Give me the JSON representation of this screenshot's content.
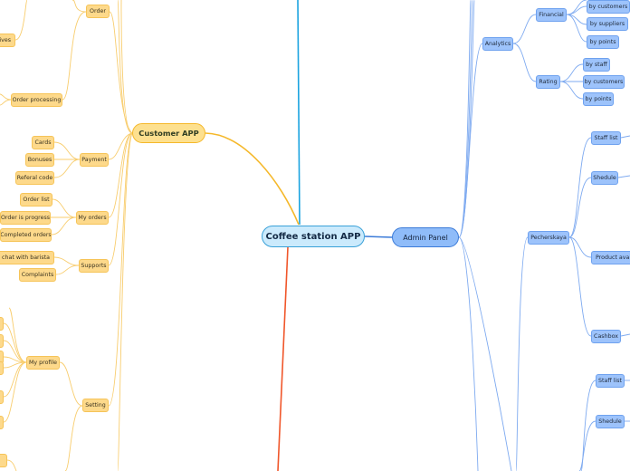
{
  "colors": {
    "customer_branch": "#f5b82a",
    "customer_leaf": "#fcd98c",
    "admin_branch": "#3b7bd8",
    "admin_leaf": "#7eaaf0",
    "top_branch": "#1aa3e0",
    "bottom_branch": "#f0562a",
    "root_fill": "#cbeafc"
  },
  "root": {
    "label": "Coffee station APP"
  },
  "customer_app": {
    "label": "Customer APP",
    "order": {
      "label": "Order"
    },
    "order_processing": {
      "label": "Order processing"
    },
    "cut_node": {
      "label": "tives"
    },
    "payment": {
      "label": "Payment",
      "children": [
        "Cards",
        "Bonuses",
        "Referal code"
      ]
    },
    "my_orders": {
      "label": "My orders",
      "children": [
        "Order list",
        "Order is progress",
        "Completed orders"
      ]
    },
    "supports": {
      "label": "Supports",
      "children": [
        "ine chat with barista",
        "Complaints"
      ]
    },
    "setting": {
      "label": "Setting"
    },
    "my_profile": {
      "label": "My profile"
    }
  },
  "admin_panel": {
    "label": "Admin Panel",
    "analytics": {
      "label": "Analytics",
      "financial": {
        "label": "Financial",
        "children": [
          "by customers",
          "by suppliers",
          "by points"
        ]
      },
      "rating": {
        "label": "Rating",
        "children": [
          "by staff",
          "by customers",
          "by points"
        ]
      }
    },
    "pecherskaya": {
      "label": "Pecherskaya",
      "children": [
        "Staff list",
        "Shedule",
        "Product availa",
        "Cashbox"
      ]
    },
    "second_location": {
      "children": [
        "Staff list",
        "Shedule"
      ]
    }
  }
}
